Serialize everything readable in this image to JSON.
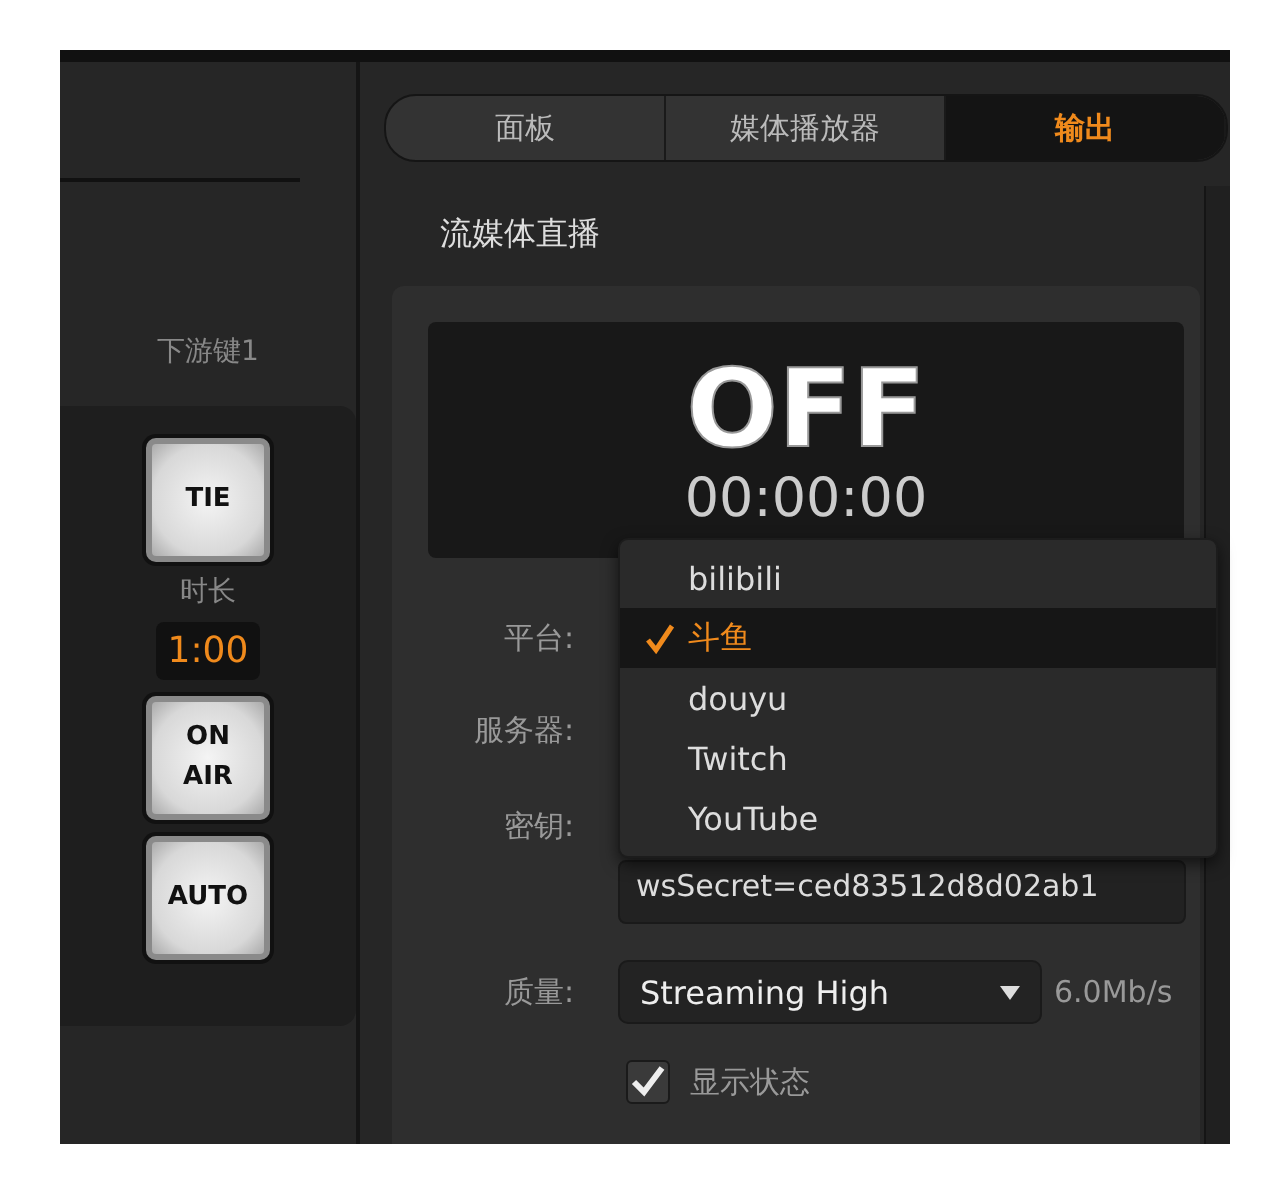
{
  "tabs": [
    {
      "label": "面板",
      "selected": false
    },
    {
      "label": "媒体播放器",
      "selected": false
    },
    {
      "label": "输出",
      "selected": true
    }
  ],
  "downstream_key": {
    "title": "下游键1",
    "tie_button": "TIE",
    "duration_label": "时长",
    "duration": "1:00",
    "buttons": [
      "ON\nAIR",
      "AUTO"
    ]
  },
  "streaming": {
    "title": "流媒体直播",
    "status": "OFF",
    "timer": "00:00:00",
    "labels": [
      "平台:",
      "服务器:",
      "密钥:"
    ],
    "key_value": "wsSecret=ced83512d8d02ab1",
    "quality_label": "质量:",
    "quality": "Streaming High",
    "bitrate": "6.0Mb/s",
    "show_status": {
      "label": "显示状态",
      "checked": true
    },
    "platform_menu": [
      {
        "label": "bilibili",
        "selected": false
      },
      {
        "label": "斗鱼",
        "selected": true
      },
      {
        "label": "douyu",
        "selected": false
      },
      {
        "label": "Twitch",
        "selected": false
      },
      {
        "label": "YouTube",
        "selected": false
      }
    ]
  }
}
